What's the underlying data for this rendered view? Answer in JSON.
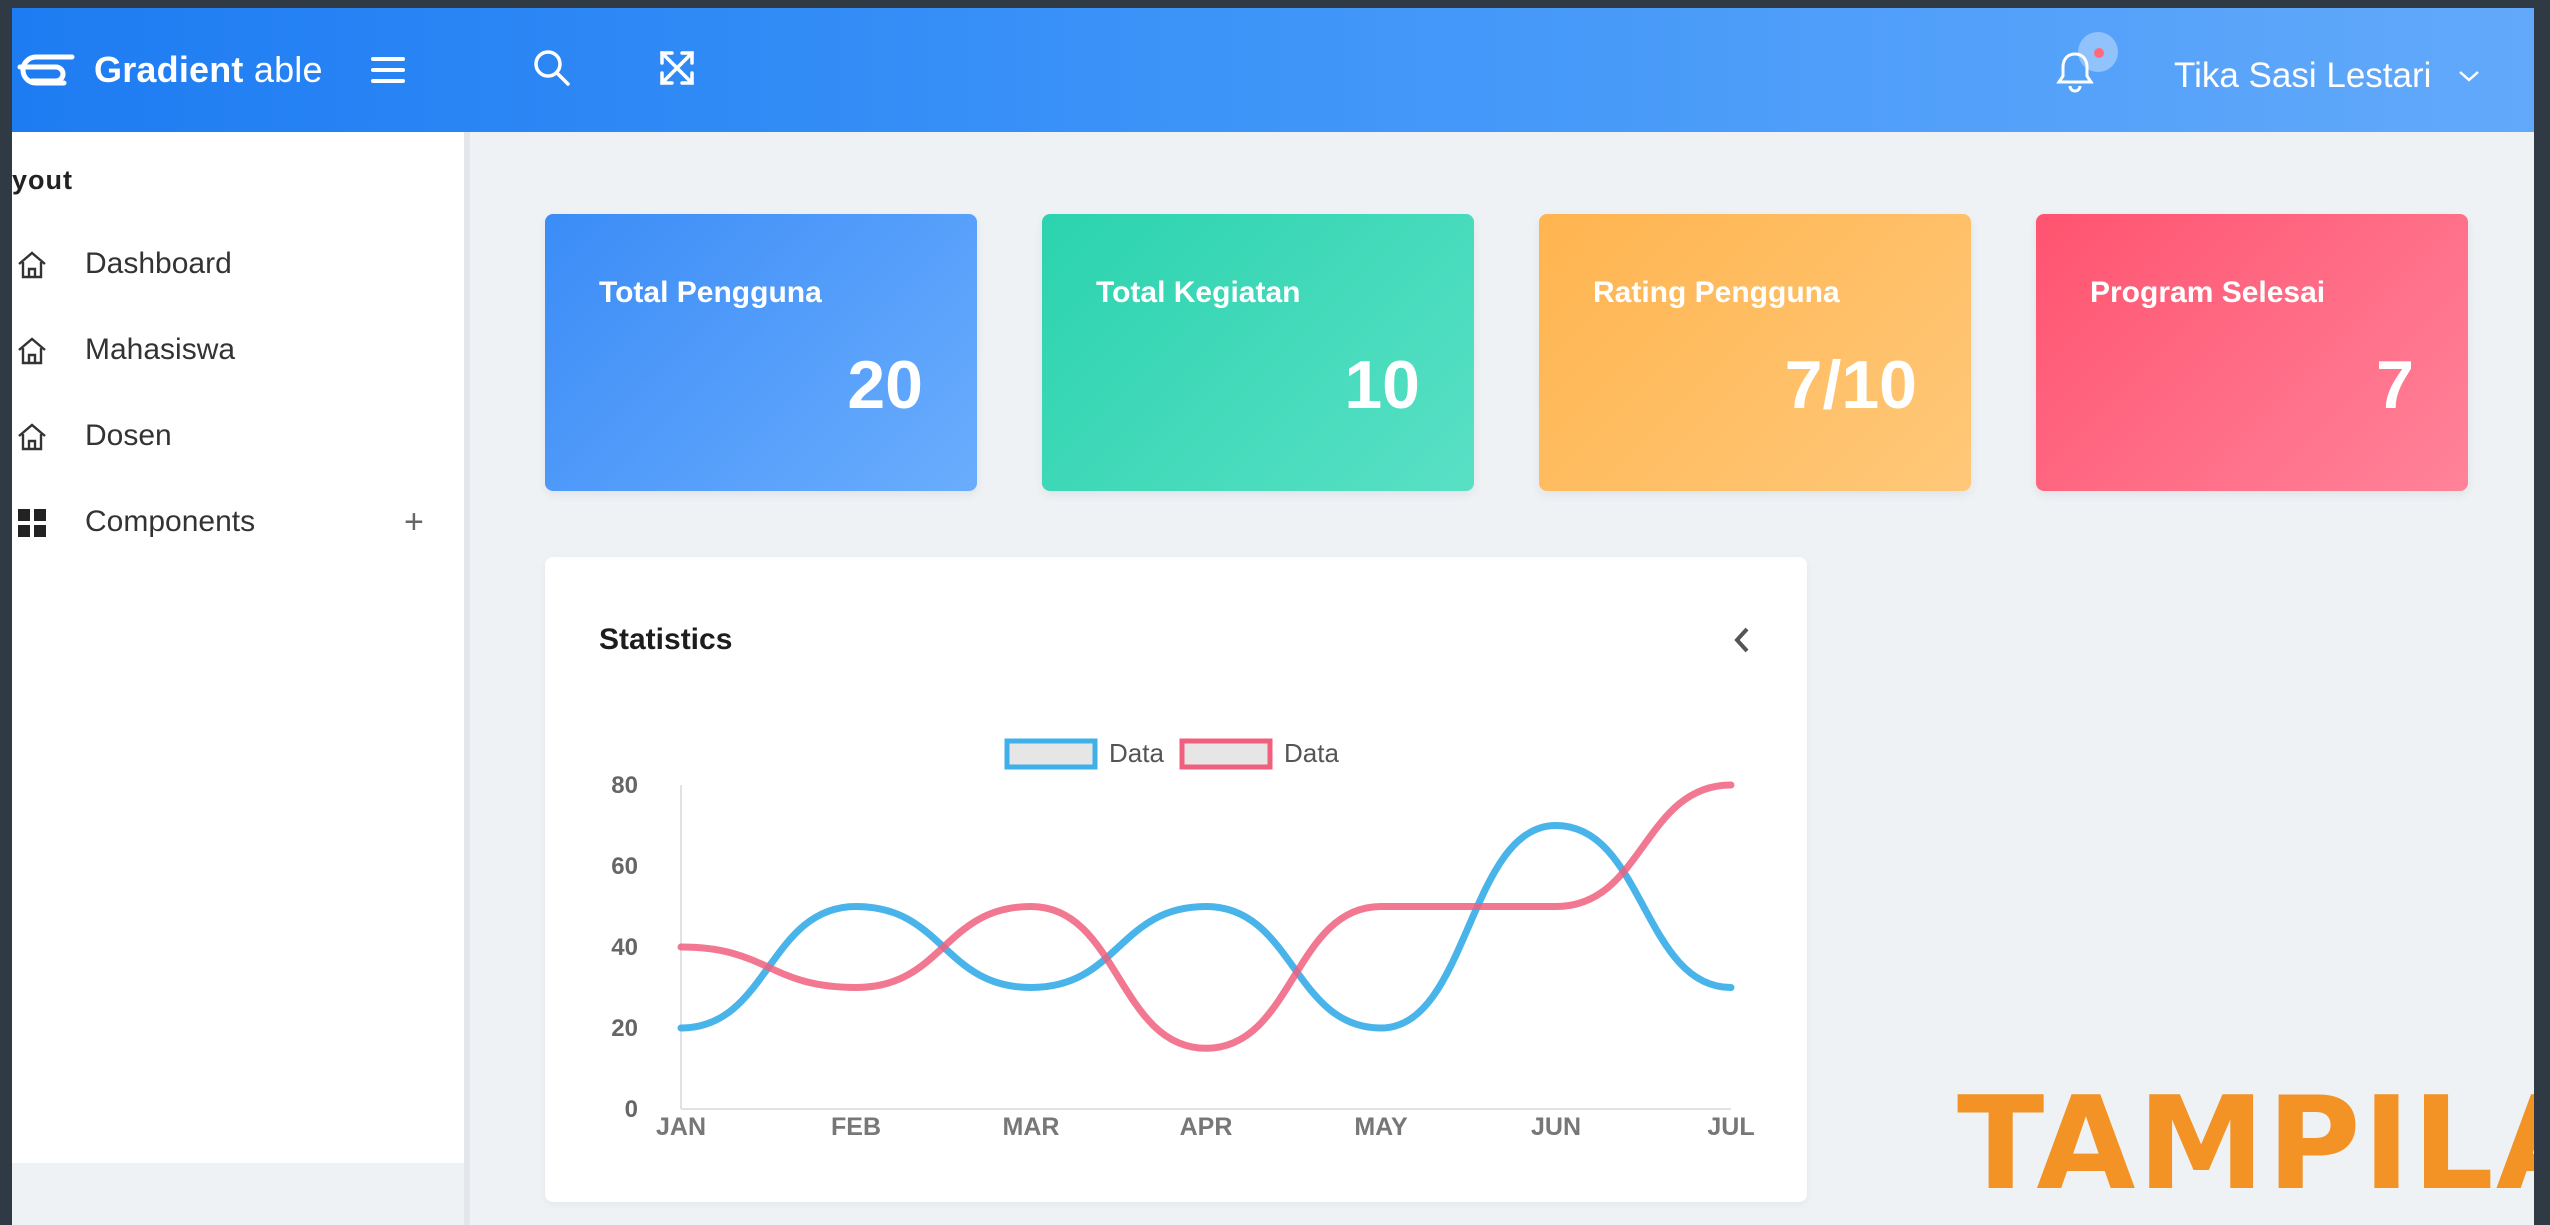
{
  "header": {
    "brand_bold": "Gradient",
    "brand_light": "able",
    "user_name": "Tika Sasi Lestari"
  },
  "sidebar": {
    "caption": "yout",
    "items": [
      {
        "label": "Dashboard",
        "icon": "home-icon"
      },
      {
        "label": "Mahasiswa",
        "icon": "home-icon"
      },
      {
        "label": "Dosen",
        "icon": "home-icon"
      },
      {
        "label": "Components",
        "icon": "grid-icon",
        "expand": "+"
      }
    ]
  },
  "cards": [
    {
      "title": "Total Pengguna",
      "value": "20",
      "color": "#4099ff"
    },
    {
      "title": "Total Kegiatan",
      "value": "10",
      "color": "#2ed8b6"
    },
    {
      "title": "Rating Pengguna",
      "value": "7/10",
      "color": "#ffb64d"
    },
    {
      "title": "Program Selesai",
      "value": "7",
      "color": "#ff5370"
    }
  ],
  "statistics": {
    "title": "Statistics"
  },
  "chart_data": {
    "type": "line",
    "categories": [
      "JAN",
      "FEB",
      "MAR",
      "APR",
      "MAY",
      "JUN",
      "JUL"
    ],
    "series": [
      {
        "name": "Data",
        "values": [
          20,
          50,
          30,
          50,
          20,
          70,
          30
        ],
        "color": "#3fb0e8"
      },
      {
        "name": "Data",
        "values": [
          40,
          30,
          50,
          15,
          50,
          50,
          80
        ],
        "color": "#f0607e"
      }
    ],
    "ylim": [
      0,
      80
    ],
    "yticks": [
      0,
      20,
      40,
      60,
      80
    ],
    "legend": "top-center",
    "grid": false
  },
  "watermark": "TAMPILAN"
}
